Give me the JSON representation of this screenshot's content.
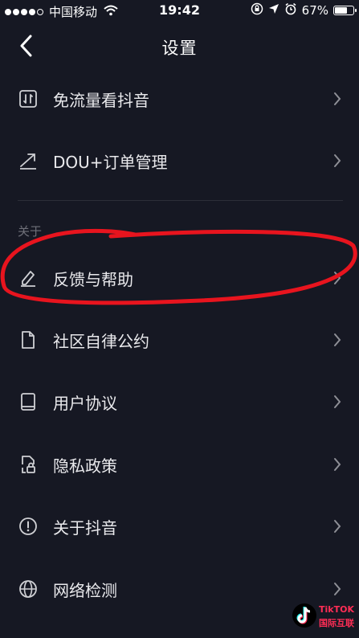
{
  "status_bar": {
    "carrier": "中国移动",
    "time": "19:42",
    "battery": "67%",
    "battery_level": 0.67
  },
  "nav": {
    "title": "设置"
  },
  "rows_top": [
    {
      "label": "免流量看抖音",
      "icon": "free-data-icon"
    },
    {
      "label": "DOU+订单管理",
      "icon": "trend-icon"
    }
  ],
  "section_about": "关于",
  "rows_about": [
    {
      "label": "反馈与帮助",
      "icon": "pencil-icon"
    },
    {
      "label": "社区自律公约",
      "icon": "document-icon"
    },
    {
      "label": "用户协议",
      "icon": "book-icon"
    },
    {
      "label": "隐私政策",
      "icon": "privacy-lock-icon"
    },
    {
      "label": "关于抖音",
      "icon": "info-icon"
    },
    {
      "label": "网络检测",
      "icon": "globe-icon"
    }
  ],
  "watermark": {
    "line1": "TikTOK",
    "line2": "国际互联"
  },
  "colors": {
    "background": "#161823",
    "annotation": "#e8141e",
    "text": "#e9e9ec",
    "muted": "#6f7079"
  }
}
